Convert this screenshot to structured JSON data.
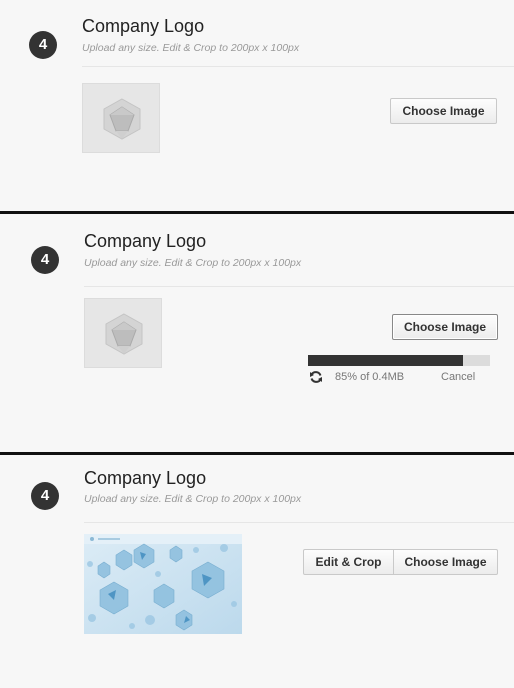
{
  "panels": [
    {
      "step": "4",
      "title": "Company Logo",
      "subtitle": "Upload any size. Edit & Crop to 200px x 100px",
      "choose_label": "Choose Image",
      "placeholder_icon": "polyhedron-placeholder-icon"
    },
    {
      "step": "4",
      "title": "Company Logo",
      "subtitle": "Upload any size. Edit & Crop to 200px x 100px",
      "choose_label": "Choose Image",
      "placeholder_icon": "polyhedron-placeholder-icon",
      "upload": {
        "progress": 0.85,
        "status_text": "85% of 0.4MB",
        "cancel_label": "Cancel",
        "status_icon": "sync-icon"
      }
    },
    {
      "step": "4",
      "title": "Company Logo",
      "subtitle": "Upload any size. Edit & Crop to 200px x 100px",
      "edit_label": "Edit & Crop",
      "choose_label": "Choose Image",
      "preview": "uploaded-logo-image"
    }
  ],
  "colors": {
    "background": "#f7f7f7",
    "divider": "#111111",
    "progress_fill": "#333333",
    "progress_track": "#dcdcdc"
  }
}
